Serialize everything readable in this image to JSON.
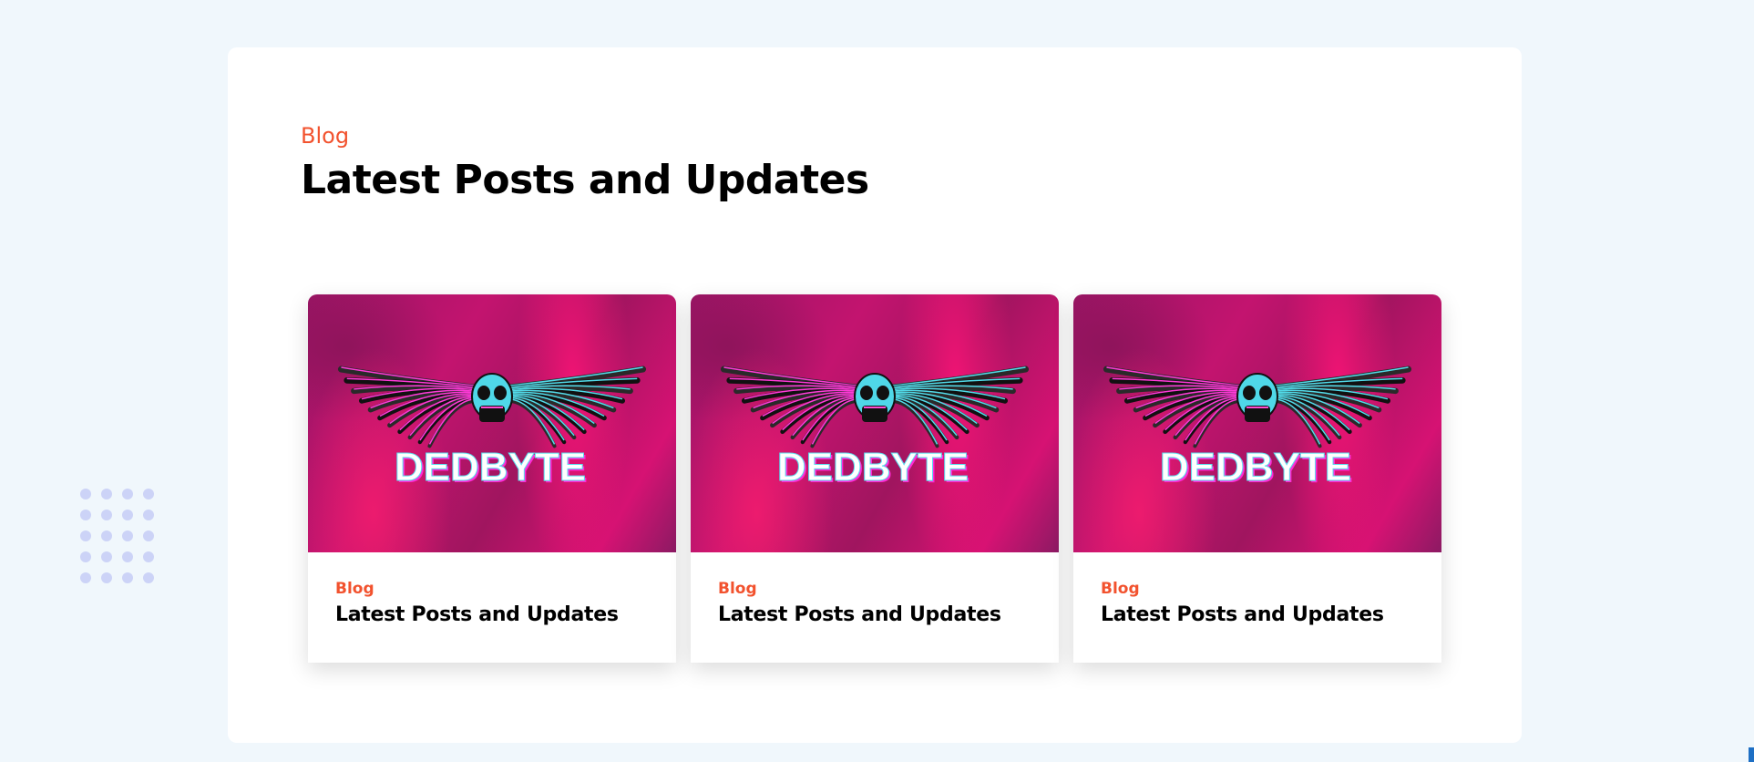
{
  "section": {
    "eyebrow": "Blog",
    "title": "Latest Posts and Updates"
  },
  "cards": [
    {
      "category": "Blog",
      "title": "Latest Posts and Updates",
      "image_text": "DEDBYTE"
    },
    {
      "category": "Blog",
      "title": "Latest Posts and Updates",
      "image_text": "DEDBYTE"
    },
    {
      "category": "Blog",
      "title": "Latest Posts and Updates",
      "image_text": "DEDBYTE"
    }
  ],
  "colors": {
    "accent": "#f2522e",
    "page_background": "#f0f7fc",
    "panel_background": "#ffffff",
    "dots": "#ccd3f7",
    "image_magenta": "#c3146f"
  },
  "icons": [
    "skull-wings-logo-icon",
    "dot-pattern-decoration"
  ]
}
